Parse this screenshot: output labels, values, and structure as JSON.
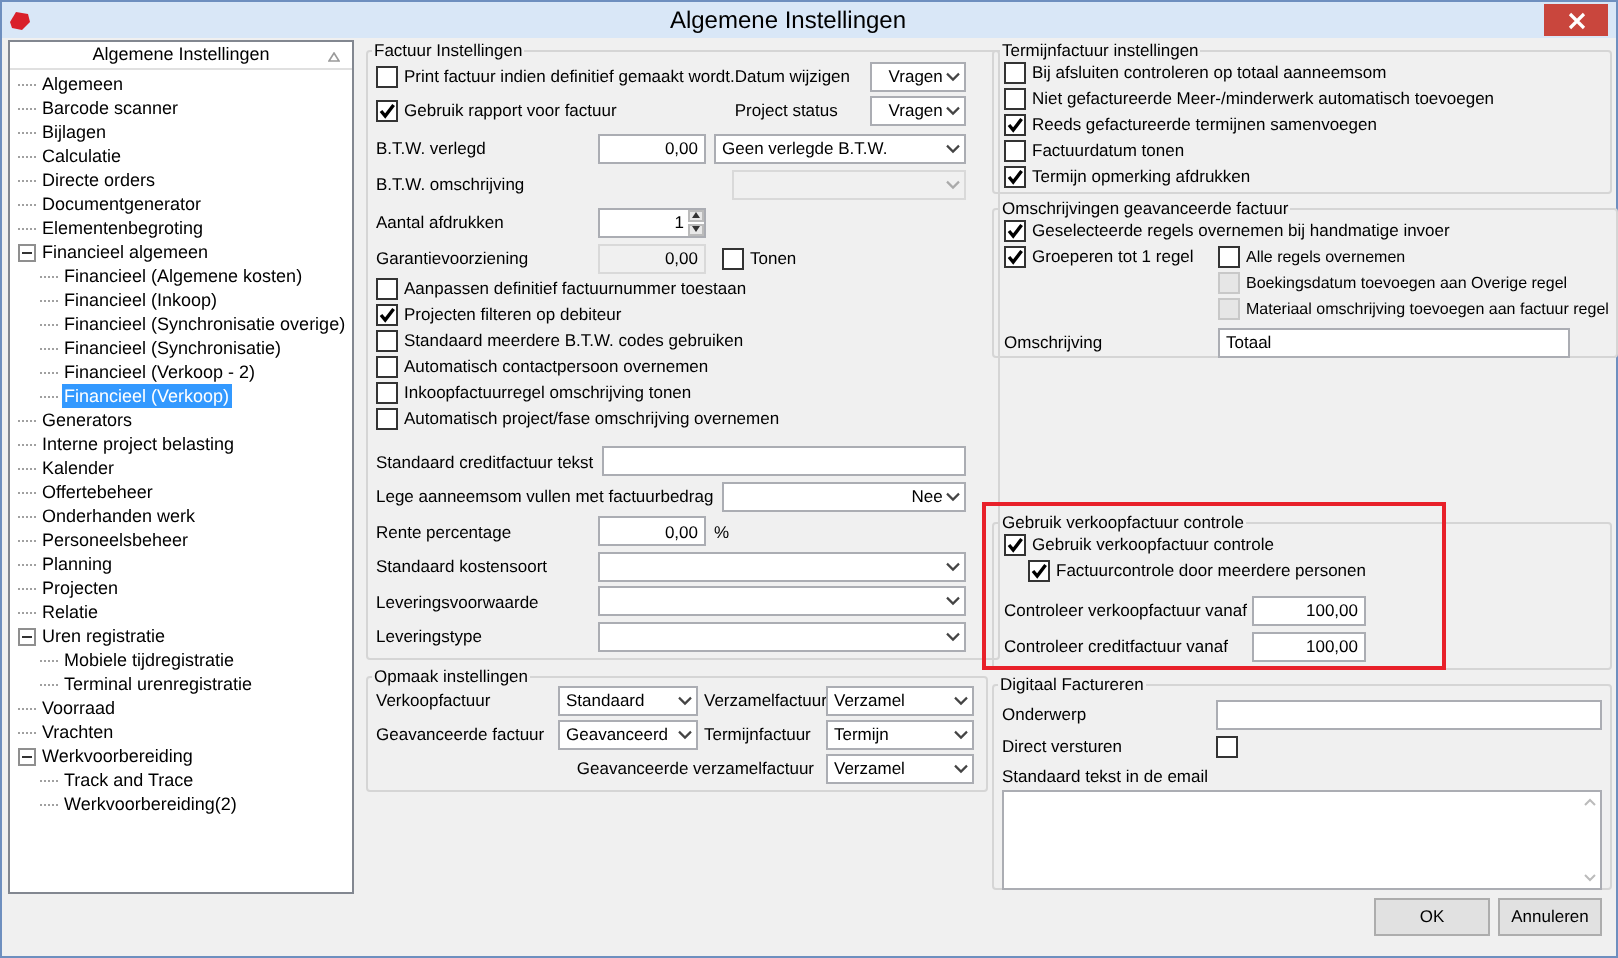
{
  "window": {
    "title": "Algemene Instellingen"
  },
  "sidebar": {
    "header": "Algemene Instellingen",
    "items": [
      {
        "label": "Algemeen",
        "selected": false
      },
      {
        "label": "Barcode scanner",
        "selected": false
      },
      {
        "label": "Bijlagen",
        "selected": false
      },
      {
        "label": "Calculatie",
        "selected": false
      },
      {
        "label": "Directe orders",
        "selected": false
      },
      {
        "label": "Documentgenerator",
        "selected": false
      },
      {
        "label": "Elementenbegroting",
        "selected": false
      },
      {
        "label": "Financieel algemeen",
        "selected": false,
        "expanded": true,
        "children": [
          {
            "label": "Financieel (Algemene kosten)",
            "selected": false
          },
          {
            "label": "Financieel (Inkoop)",
            "selected": false
          },
          {
            "label": "Financieel (Synchronisatie overige)",
            "selected": false
          },
          {
            "label": "Financieel (Synchronisatie)",
            "selected": false
          },
          {
            "label": "Financieel (Verkoop - 2)",
            "selected": false
          },
          {
            "label": "Financieel (Verkoop)",
            "selected": true
          }
        ]
      },
      {
        "label": "Generators",
        "selected": false
      },
      {
        "label": "Interne project belasting",
        "selected": false
      },
      {
        "label": "Kalender",
        "selected": false
      },
      {
        "label": "Offertebeheer",
        "selected": false
      },
      {
        "label": "Onderhanden werk",
        "selected": false
      },
      {
        "label": "Personeelsbeheer",
        "selected": false
      },
      {
        "label": "Planning",
        "selected": false
      },
      {
        "label": "Projecten",
        "selected": false
      },
      {
        "label": "Relatie",
        "selected": false
      },
      {
        "label": "Uren registratie",
        "selected": false,
        "expanded": true,
        "children": [
          {
            "label": "Mobiele tijdregistratie",
            "selected": false
          },
          {
            "label": "Terminal urenregistratie",
            "selected": false
          }
        ]
      },
      {
        "label": "Voorraad",
        "selected": false
      },
      {
        "label": "Vrachten",
        "selected": false
      },
      {
        "label": "Werkvoorbereiding",
        "selected": false,
        "expanded": true,
        "children": [
          {
            "label": "Track and Trace",
            "selected": false
          },
          {
            "label": "Werkvoorbereiding(2)",
            "selected": false
          }
        ]
      }
    ]
  },
  "factuur_instellingen": {
    "title": "Factuur Instellingen",
    "print_factuur": {
      "label": "Print factuur indien definitief gemaakt wordt.",
      "checked": false
    },
    "datum_wijzigen": {
      "label": "Datum wijzigen",
      "value": "Vragen"
    },
    "gebruik_rapport": {
      "label": "Gebruik rapport voor factuur",
      "checked": true
    },
    "project_status": {
      "label": "Project status",
      "value": "Vragen"
    },
    "btw_verlegd": {
      "label": "B.T.W. verlegd",
      "value": "0,00",
      "option": "Geen verlegde B.T.W."
    },
    "btw_omschrijving": {
      "label": "B.T.W. omschrijving",
      "disabled": true
    },
    "aantal_afdrukken": {
      "label": "Aantal afdrukken",
      "value": "1"
    },
    "garantievoorziening": {
      "label": "Garantievoorziening",
      "value": "0,00",
      "disabled": true,
      "tonen": {
        "label": "Tonen",
        "checked": false
      }
    },
    "options": [
      {
        "label": "Aanpassen definitief factuurnummer toestaan",
        "checked": false
      },
      {
        "label": "Projecten filteren op debiteur",
        "checked": true
      },
      {
        "label": "Standaard meerdere B.T.W. codes gebruiken",
        "checked": false
      },
      {
        "label": "Automatisch contactpersoon overnemen",
        "checked": false
      },
      {
        "label": "Inkoopfactuurregel omschrijving tonen",
        "checked": false
      },
      {
        "label": "Automatisch project/fase omschrijving overnemen",
        "checked": false
      }
    ],
    "fields": [
      {
        "kind": "text",
        "label": "Standaard creditfactuur tekst"
      },
      {
        "kind": "select",
        "label": "Lege aanneemsom vullen met factuurbedrag",
        "value": "Nee"
      },
      {
        "kind": "number",
        "label": "Rente percentage",
        "value": "0,00",
        "unit": "%"
      },
      {
        "kind": "select",
        "label": "Standaard kostensoort"
      },
      {
        "kind": "select",
        "label": "Leveringsvoorwaarde"
      },
      {
        "kind": "select",
        "label": "Leveringstype"
      }
    ]
  },
  "opmaak_instellingen": {
    "title": "Opmaak instellingen",
    "fields": [
      {
        "label": "Verkoopfactuur",
        "value": "Standaard"
      },
      {
        "label": "Verzamelfactuur",
        "value": "Verzamel"
      },
      {
        "label": "Geavanceerde factuur",
        "value": "Geavanceerd"
      },
      {
        "label": "Termijnfactuur",
        "value": "Termijn"
      },
      {
        "label": "Geavanceerde verzamelfactuur",
        "value": "Verzamel"
      }
    ]
  },
  "termijnfactuur_instellingen": {
    "title": "Termijnfactuur instellingen",
    "options": [
      {
        "label": "Bij afsluiten controleren op totaal aanneemsom",
        "checked": false
      },
      {
        "label": "Niet gefactureerde Meer-/minderwerk automatisch toevoegen",
        "checked": false
      },
      {
        "label": "Reeds gefactureerde termijnen samenvoegen",
        "checked": true
      },
      {
        "label": "Factuurdatum tonen",
        "checked": false
      },
      {
        "label": "Termijn opmerking afdrukken",
        "checked": true
      }
    ]
  },
  "omschrijvingen": {
    "title": "Omschrijvingen geavanceerde factuur",
    "geselecteerde_regels": {
      "label": "Geselecteerde regels overnemen bij handmatige invoer",
      "checked": true
    },
    "groeperen": {
      "label": "Groeperen tot 1 regel",
      "checked": true
    },
    "sub_options": [
      {
        "label": "Alle regels overnemen",
        "checked": false,
        "disabled": false
      },
      {
        "label": "Boekingsdatum toevoegen aan Overige regel",
        "checked": false,
        "disabled": true
      },
      {
        "label": "Materiaal omschrijving toevoegen aan factuur regel",
        "checked": false,
        "disabled": true
      }
    ],
    "omschrijving": {
      "label": "Omschrijving",
      "value": "Totaal"
    }
  },
  "verkoopfactuur_controle": {
    "title": "Gebruik verkoopfactuur controle",
    "highlighted": true,
    "options": [
      {
        "label": "Gebruik verkoopfactuur controle",
        "checked": true
      },
      {
        "label": "Factuurcontrole door meerdere personen",
        "checked": true
      }
    ],
    "fields": [
      {
        "label": "Controleer verkoopfactuur vanaf",
        "value": "100,00"
      },
      {
        "label": "Controleer creditfactuur vanaf",
        "value": "100,00"
      }
    ]
  },
  "digitaal_factureren": {
    "title": "Digitaal Factureren",
    "onderwerp_label": "Onderwerp",
    "direct_versturen": {
      "label": "Direct versturen",
      "checked": false
    },
    "email_label": "Standaard tekst in de email"
  },
  "buttons": [
    {
      "label": "OK"
    },
    {
      "label": "Annuleren"
    }
  ]
}
